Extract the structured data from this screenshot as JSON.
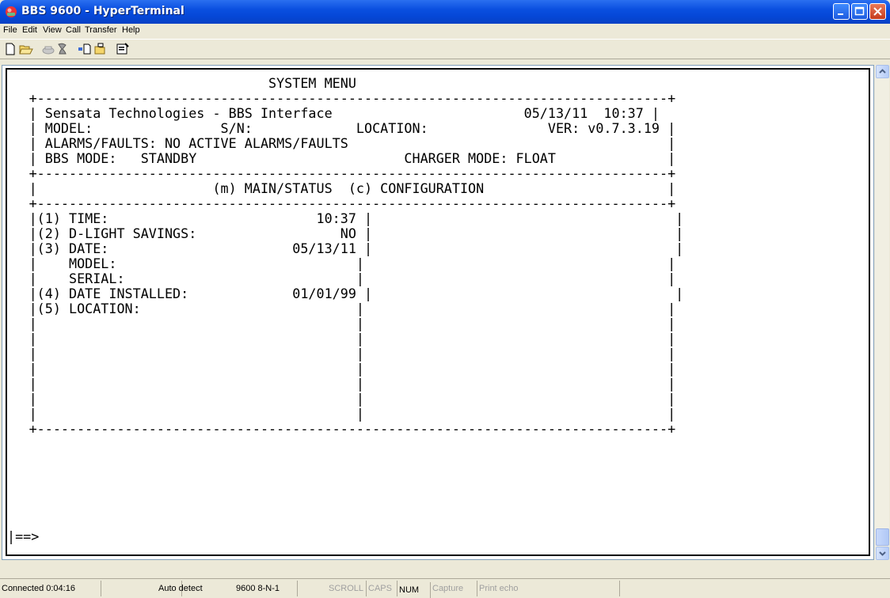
{
  "window": {
    "title": "BBS 9600 - HyperTerminal",
    "icon": "hyperterminal-phone-icon",
    "controls": [
      "minimize-icon",
      "maximize-icon",
      "close-icon"
    ]
  },
  "menu": {
    "items": [
      "File",
      "Edit",
      "View",
      "Call",
      "Transfer",
      "Help"
    ]
  },
  "toolbar": {
    "icons": [
      "new-icon",
      "open-icon",
      "call-icon",
      "disconnect-icon",
      "send-icon",
      "receive-icon",
      "properties-icon"
    ]
  },
  "terminal": {
    "lines": [
      "                              SYSTEM MENU",
      "+-------------------------------------------------------------------------------+",
      "| Sensata Technologies - BBS Interface                        05/13/11  10:37 |",
      "| MODEL:                S/N:             LOCATION:               VER: v0.7.3.19 |",
      "| ALARMS/FAULTS: NO ACTIVE ALARMS/FAULTS                                        |",
      "| BBS MODE:   STANDBY                          CHARGER MODE: FLOAT              |",
      "+-------------------------------------------------------------------------------+",
      "|                      (m) MAIN/STATUS  (c) CONFIGURATION                       |",
      "+-------------------------------------------------------------------------------+",
      "|(1) TIME:                          10:37 |                                      |",
      "|(2) D-LIGHT SAVINGS:                  NO |                                      |",
      "|(3) DATE:                       05/13/11 |                                      |",
      "|    MODEL:                              |                                      |",
      "|    SERIAL:                             |                                      |",
      "|(4) DATE INSTALLED:             01/01/99 |                                      |",
      "|(5) LOCATION:                           |                                      |",
      "|                                        |                                      |",
      "|                                        |                                      |",
      "|                                        |                                      |",
      "|                                        |                                      |",
      "|                                        |                                      |",
      "|                                        |                                      |",
      "|                                        |                                      |",
      "+-------------------------------------------------------------------------------+",
      "|                                                                               ",
      "|                                                                               ",
      "|==>"
    ]
  },
  "status": {
    "connected": "Connected 0:04:16",
    "detect": "Auto detect",
    "settings": "9600 8-N-1",
    "scroll": "SCROLL",
    "caps": "CAPS",
    "num": "NUM",
    "capture": "Capture",
    "print_echo": "Print echo"
  }
}
